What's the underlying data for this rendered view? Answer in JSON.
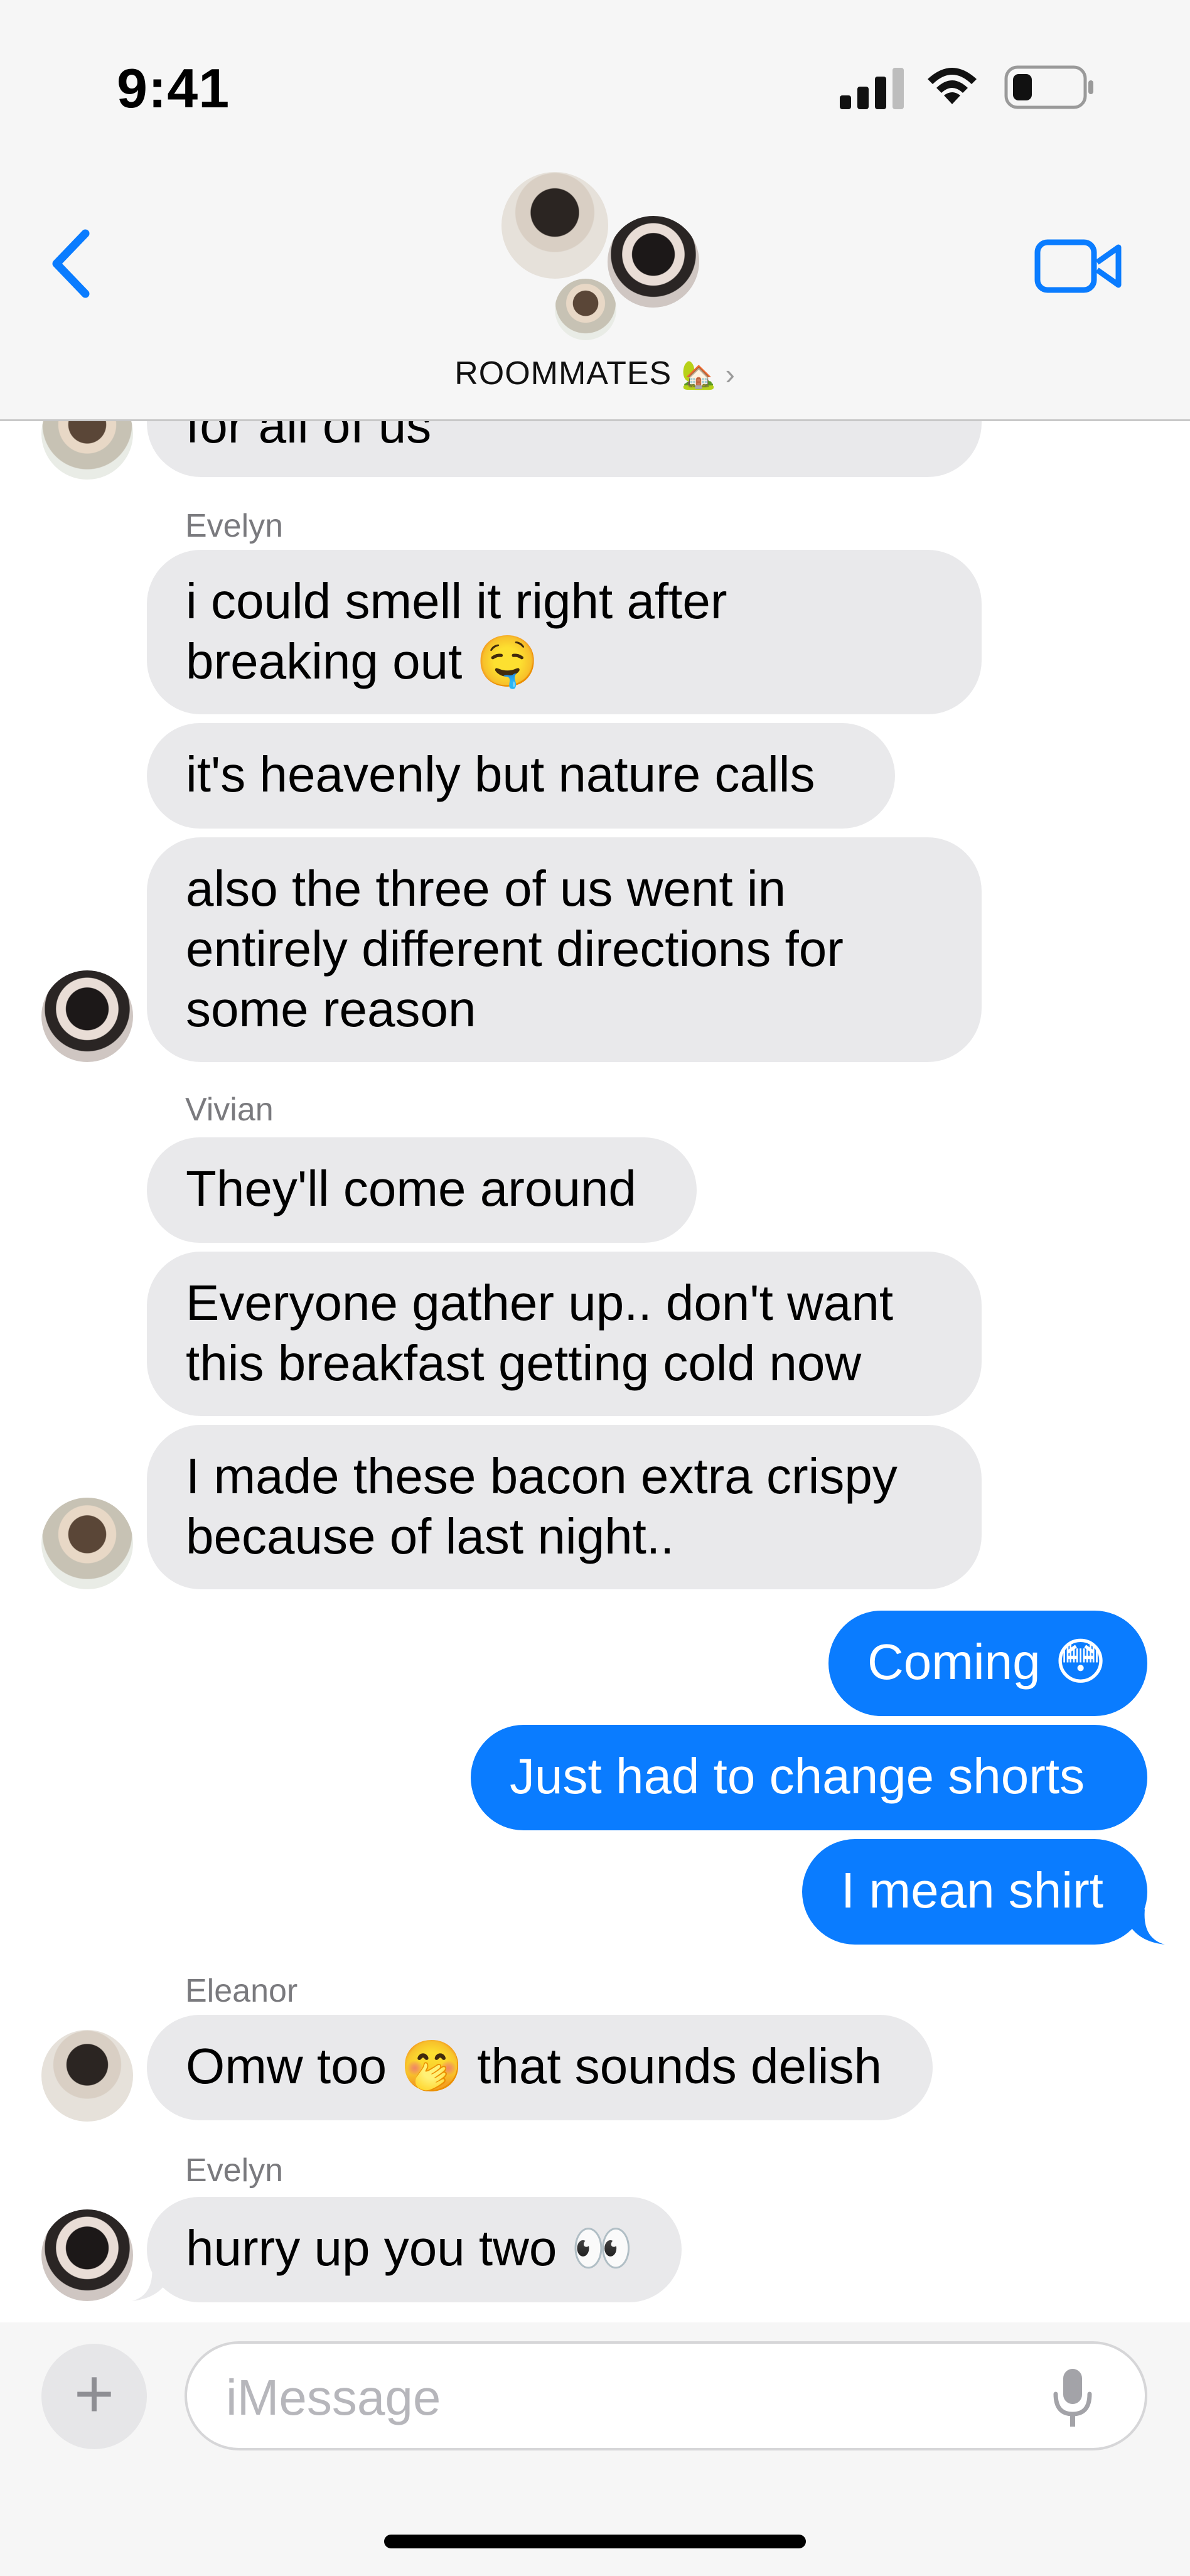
{
  "status_bar": {
    "time": "9:41"
  },
  "header": {
    "group_name": "ROOMMATES",
    "group_emoji": "🏡",
    "chevron": "›"
  },
  "icons": {
    "back": "chevron-left-icon",
    "video": "video-camera-icon",
    "signal": "cellular-signal-icon",
    "wifi": "wifi-icon",
    "battery": "battery-icon",
    "plus": "plus-icon",
    "mic": "microphone-icon"
  },
  "colors": {
    "outgoing_bubble": "#0a7cff",
    "incoming_bubble": "#e9e9eb",
    "accent": "#0a7cff"
  },
  "messages": [
    {
      "dir": "in",
      "text": "for all of us"
    },
    {
      "dir": "in",
      "sender": "Evelyn",
      "text": "i could smell it right after\nbreaking out 🤤"
    },
    {
      "dir": "in",
      "text": "it's heavenly but nature calls"
    },
    {
      "dir": "in",
      "text": "also the three of us went in\nentirely different directions for\nsome reason"
    },
    {
      "dir": "in",
      "sender": "Vivian",
      "text": "They'll come around"
    },
    {
      "dir": "in",
      "text": "Everyone gather up.. don't want\nthis breakfast getting cold now"
    },
    {
      "dir": "in",
      "text": "I made these bacon extra crispy\nbecause of last night.."
    },
    {
      "dir": "out",
      "text": "Coming 😳"
    },
    {
      "dir": "out",
      "text": "Just had to change shorts"
    },
    {
      "dir": "out",
      "text": "I mean shirt"
    },
    {
      "dir": "in",
      "sender": "Eleanor",
      "text": "Omw too 🤭 that sounds delish"
    },
    {
      "dir": "in",
      "sender": "Evelyn",
      "text": "hurry up you two 👀"
    }
  ],
  "composer": {
    "placeholder": "iMessage",
    "plus_label": "+"
  }
}
